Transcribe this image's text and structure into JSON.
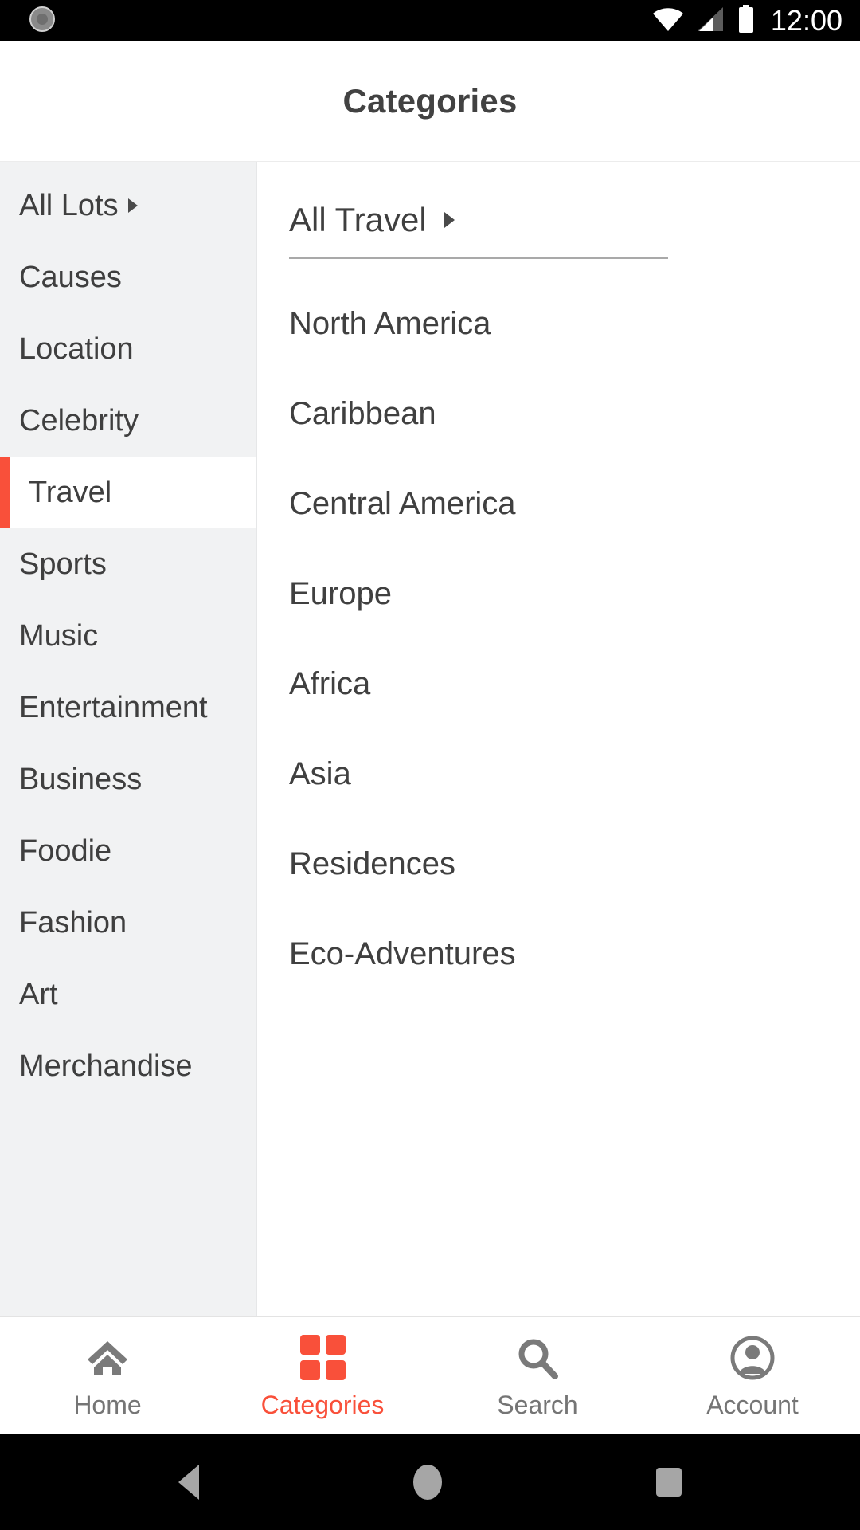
{
  "status_bar": {
    "time": "12:00",
    "icons": [
      "app-badge-icon",
      "wifi-icon",
      "cellular-signal-icon",
      "battery-icon"
    ]
  },
  "header": {
    "title": "Categories"
  },
  "sidebar": {
    "items": [
      {
        "label": "All Lots",
        "caret": true,
        "active": false
      },
      {
        "label": "Causes",
        "caret": false,
        "active": false
      },
      {
        "label": "Location",
        "caret": false,
        "active": false
      },
      {
        "label": "Celebrity",
        "caret": false,
        "active": false
      },
      {
        "label": "Travel",
        "caret": false,
        "active": true
      },
      {
        "label": "Sports",
        "caret": false,
        "active": false
      },
      {
        "label": "Music",
        "caret": false,
        "active": false
      },
      {
        "label": "Entertainment",
        "caret": false,
        "active": false
      },
      {
        "label": "Business",
        "caret": false,
        "active": false
      },
      {
        "label": "Foodie",
        "caret": false,
        "active": false
      },
      {
        "label": "Fashion",
        "caret": false,
        "active": false
      },
      {
        "label": "Art",
        "caret": false,
        "active": false
      },
      {
        "label": "Merchandise",
        "caret": false,
        "active": false
      }
    ]
  },
  "content": {
    "all_label": "All Travel",
    "all_caret": true,
    "subcategories": [
      {
        "label": "North America"
      },
      {
        "label": "Caribbean"
      },
      {
        "label": "Central America"
      },
      {
        "label": "Europe"
      },
      {
        "label": "Africa"
      },
      {
        "label": "Asia"
      },
      {
        "label": "Residences"
      },
      {
        "label": "Eco-Adventures"
      }
    ]
  },
  "tab_bar": {
    "tabs": [
      {
        "label": "Home",
        "icon": "home-icon",
        "active": false
      },
      {
        "label": "Categories",
        "icon": "grid-icon",
        "active": true
      },
      {
        "label": "Search",
        "icon": "search-icon",
        "active": false
      },
      {
        "label": "Account",
        "icon": "account-icon",
        "active": false
      }
    ]
  },
  "nav_bar": {
    "buttons": [
      "back-icon",
      "home-circle-icon",
      "recents-square-icon"
    ]
  },
  "colors": {
    "accent": "#f9503a",
    "sidebar_bg": "#f1f2f3",
    "text": "#3f3f3f",
    "muted_text": "#757575",
    "divider": "#a9a9a9"
  }
}
